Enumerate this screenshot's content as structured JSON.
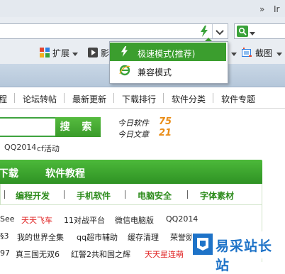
{
  "browser": {
    "tabstrip_chevron": "»",
    "tabstrip_text": "Ir",
    "toolbar": {
      "extensions_label": "扩展",
      "video_label": "影",
      "screenshot_label": "截图"
    }
  },
  "mode_menu": {
    "items": [
      {
        "label": "极速模式(推荐)",
        "selected": true
      },
      {
        "label": "兼容模式",
        "selected": false
      }
    ]
  },
  "nav": {
    "items": [
      "程",
      "论坛转帖",
      "最新更新",
      "下载排行",
      "软件分类",
      "软件专题"
    ]
  },
  "site_search": {
    "button_label": "搜 索",
    "stats": [
      {
        "label": "今日软件",
        "value": "75"
      },
      {
        "label": "今日文章",
        "value": "21"
      }
    ],
    "hot_terms": [
      "QQ2014",
      "cf活动"
    ]
  },
  "section": {
    "tabs": [
      "下载",
      "软件教程"
    ],
    "categories": [
      "编程开发",
      "手机软件",
      "电脑安全",
      "字体素材"
    ],
    "rows": [
      [
        {
          "t": "See",
          "red": false
        },
        {
          "t": "天天飞车",
          "red": true
        },
        {
          "t": "11对战平台",
          "red": false
        },
        {
          "t": "微信电脑版",
          "red": false
        },
        {
          "t": "QQ2014",
          "red": false
        }
      ],
      [
        {
          "t": "§3",
          "red": false
        },
        {
          "t": "我的世界全集",
          "red": false
        },
        {
          "t": "qq超市辅助",
          "red": false
        },
        {
          "t": "缓存清理",
          "red": false
        },
        {
          "t": "荣誉勋章",
          "red": false
        }
      ],
      [
        {
          "t": "97",
          "red": false
        },
        {
          "t": "真三国无双6",
          "red": false
        },
        {
          "t": "红警2共和国之辉",
          "red": false
        },
        {
          "t": "天天星连萌",
          "red": true
        }
      ]
    ]
  },
  "watermark": {
    "text": "易采站长站"
  },
  "colors": {
    "accent_green": "#3b9e2e",
    "stat_orange": "#e98b14",
    "hot_red": "#e02020"
  }
}
